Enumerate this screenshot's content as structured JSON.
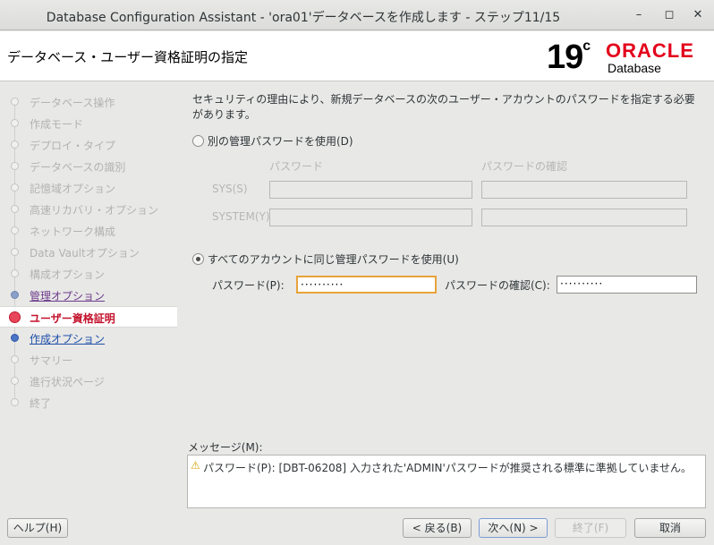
{
  "window": {
    "title": "Database Configuration Assistant - 'ora01'データベースを作成します - ステップ11/15",
    "minimize": "–",
    "maximize": "◻",
    "close": "✕"
  },
  "header": {
    "page_title": "データベース・ユーザー資格証明の指定",
    "logo_version": "19",
    "logo_version_sup": "c",
    "logo_brand": "ORACLE",
    "logo_product": "Database"
  },
  "sidebar": {
    "steps": [
      {
        "label": "データベース操作",
        "state": "disabled"
      },
      {
        "label": "作成モード",
        "state": "disabled"
      },
      {
        "label": "デプロイ・タイプ",
        "state": "disabled"
      },
      {
        "label": "データベースの識別",
        "state": "disabled"
      },
      {
        "label": "記憶域オプション",
        "state": "disabled"
      },
      {
        "label": "高速リカバリ・オプション",
        "state": "disabled"
      },
      {
        "label": "ネットワーク構成",
        "state": "disabled"
      },
      {
        "label": "Data Vaultオプション",
        "state": "disabled"
      },
      {
        "label": "構成オプション",
        "state": "disabled"
      },
      {
        "label": "管理オプション",
        "state": "done"
      },
      {
        "label": "ユーザー資格証明",
        "state": "current"
      },
      {
        "label": "作成オプション",
        "state": "next"
      },
      {
        "label": "サマリー",
        "state": "disabled"
      },
      {
        "label": "進行状況ページ",
        "state": "disabled"
      },
      {
        "label": "終了",
        "state": "disabled"
      }
    ]
  },
  "main": {
    "description": "セキュリティの理由により、新規データベースの次のユーザー・アカウントのパスワードを指定する必要があります。",
    "option_separate": "別の管理パスワードを使用(D)",
    "col_password": "パスワード",
    "col_confirm": "パスワードの確認",
    "row_sys": "SYS(S)",
    "row_system": "SYSTEM(Y)",
    "option_same": "すべてのアカウントに同じ管理パスワードを使用(U)",
    "password_label": "パスワード(P):",
    "password_value": "··········",
    "confirm_label": "パスワードの確認(C):",
    "confirm_value": "··········",
    "message_label": "メッセージ(M):",
    "message_text": "パスワード(P): [DBT-06208] 入力された'ADMIN'パスワードが推奨される標準に準拠していません。"
  },
  "buttons": {
    "help": "ヘルプ(H)",
    "back": "< 戻る(B)",
    "next": "次へ(N) >",
    "finish": "終了(F)",
    "cancel": "取消"
  }
}
